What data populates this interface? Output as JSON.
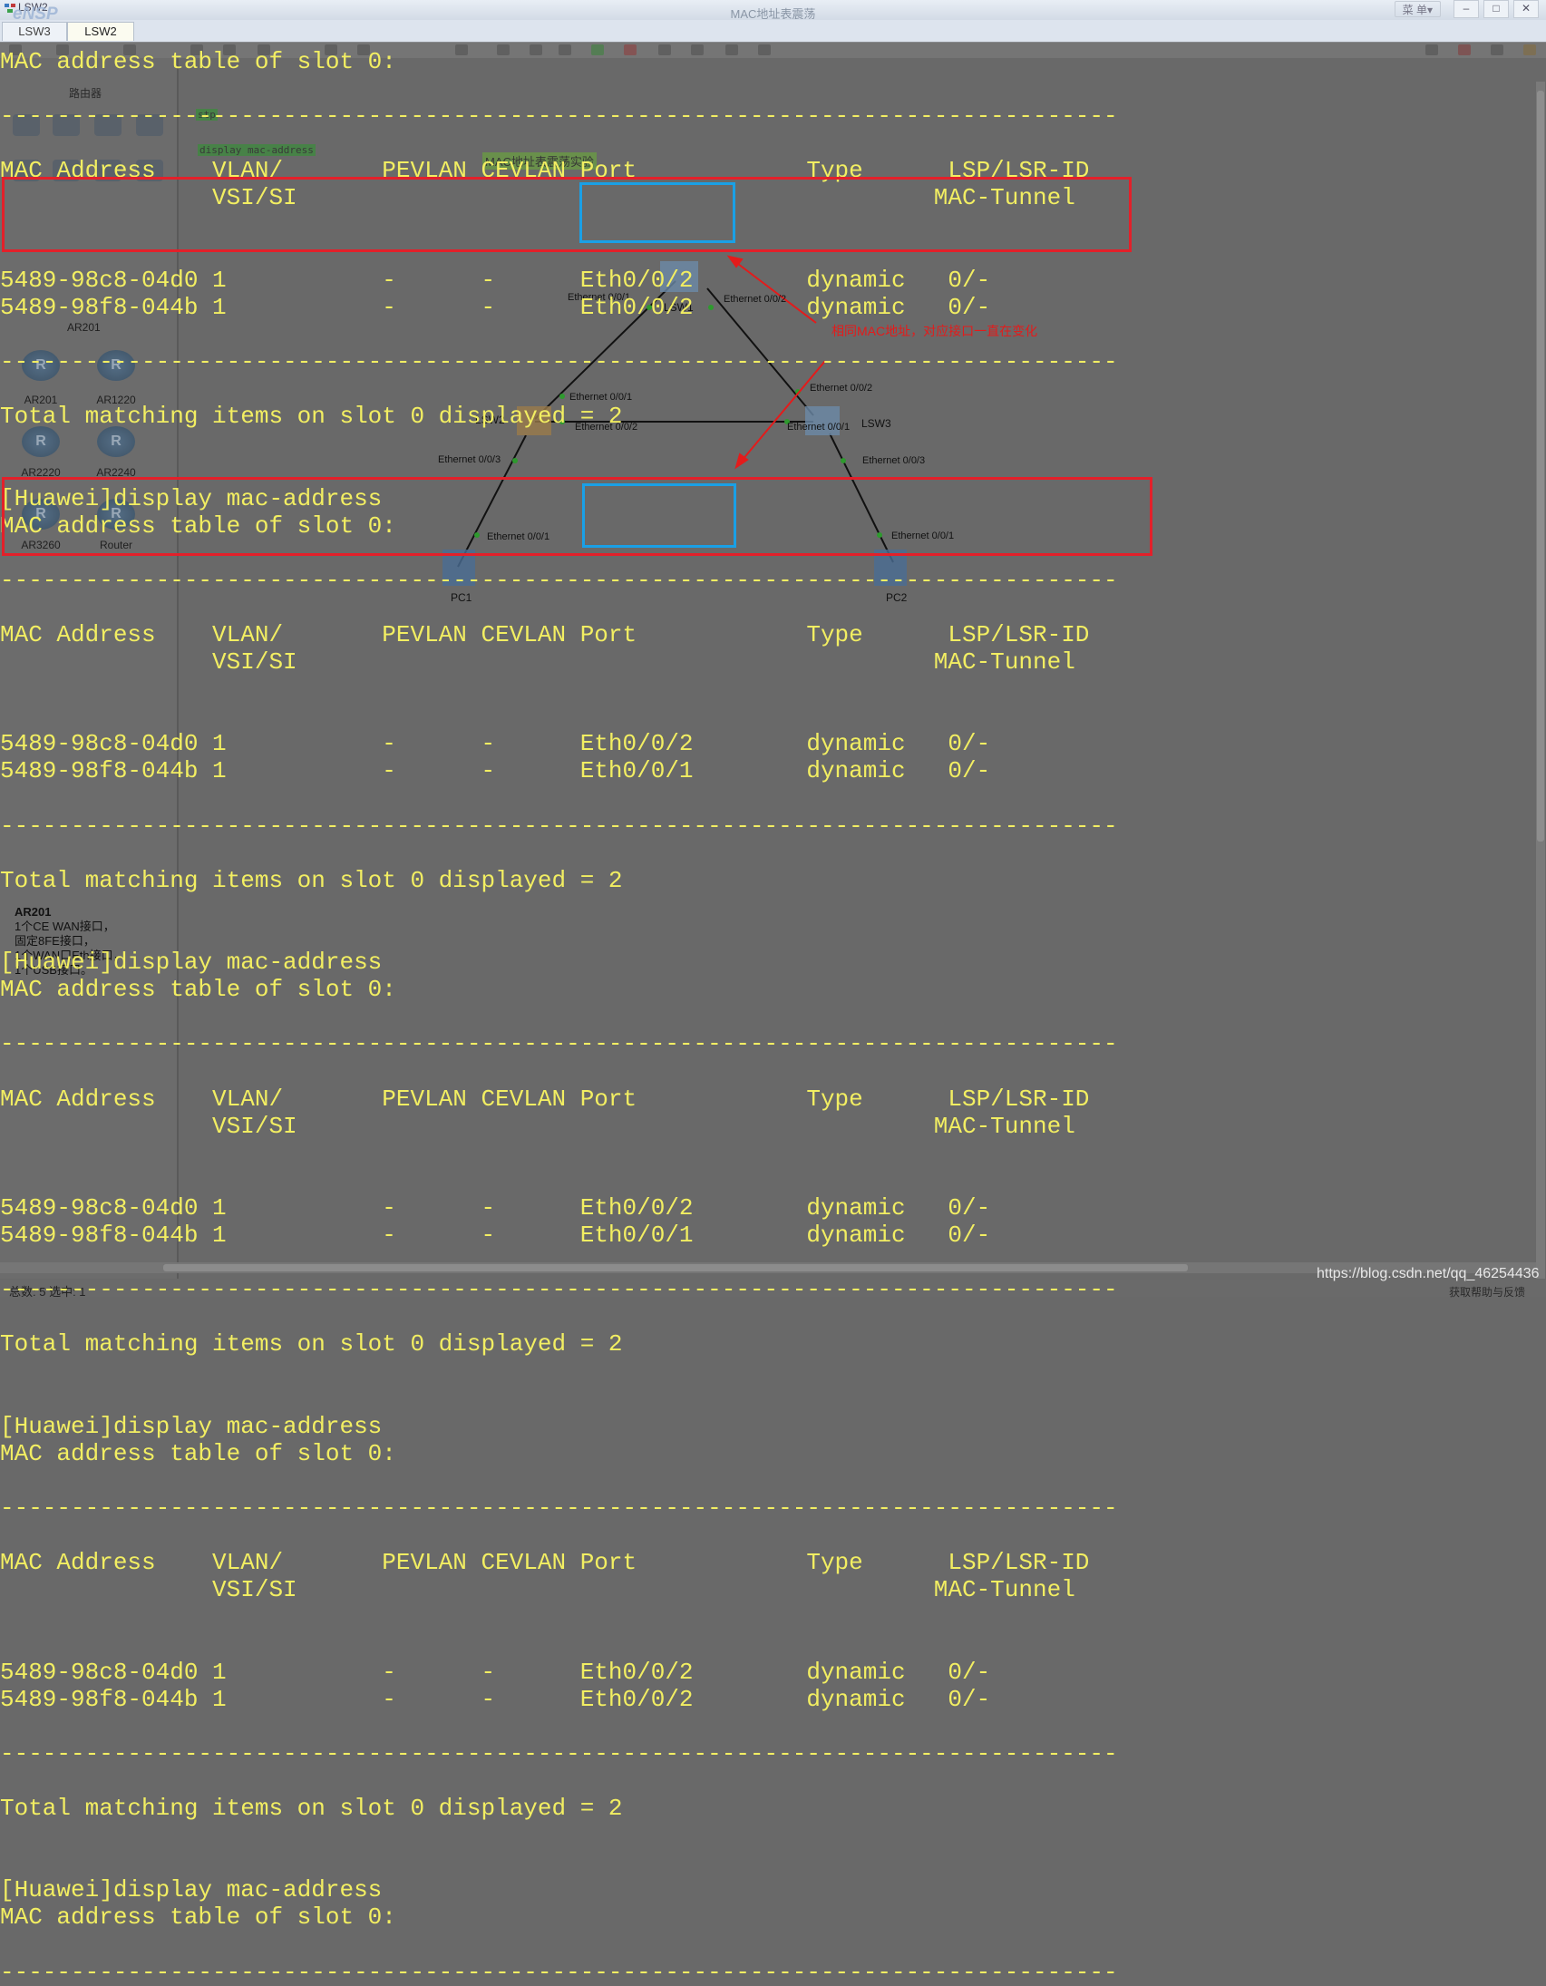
{
  "window": {
    "app_label": "LSW2",
    "brand": "eNSP",
    "title": "MAC地址表震荡",
    "menu_label": "菜 单▾",
    "minimize": "–",
    "maximize": "□",
    "close": "✕"
  },
  "tabs": [
    {
      "label": "LSW3",
      "active": false
    },
    {
      "label": "LSW2",
      "active": true
    }
  ],
  "ghost": {
    "panel_heading": "路由器",
    "routers": [
      "AR201",
      "AR1220",
      "AR2220",
      "AR2240",
      "AR3260",
      "Router"
    ],
    "selected_group": "AR201",
    "tags": [
      "stp",
      "display mac-address",
      "MAC地址表震荡实验"
    ],
    "nodes": [
      "LSW1",
      "LSW2",
      "LSW3",
      "PC1",
      "PC2"
    ],
    "ports": [
      "Ethernet 0/0/1",
      "Ethernet 0/0/2",
      "Ethernet 0/0/1",
      "Ethernet 0/0/2",
      "Ethernet 0/0/2",
      "Ethernet 0/0/1",
      "Ethernet 0/0/3",
      "Ethernet 0/0/3",
      "Ethernet 0/0/1",
      "Ethernet 0/0/1"
    ],
    "annotation": "相同MAC地址，对应接口一直在变化",
    "info": {
      "title": "AR201",
      "lines": [
        "1个CE WAN接口，",
        "固定8FE接口，",
        "1个WAN口Eth接口，",
        "1个USB接口。"
      ]
    },
    "status_left": "总数: 5 选中: 1",
    "status_right": "获取帮助与反馈"
  },
  "watermark": "https://blog.csdn.net/qq_46254436",
  "accent_colors": {
    "terminal_text": "#f2ee62",
    "highlight_red": "#e3202a",
    "highlight_blue": "#1aa0e6"
  },
  "terminal": {
    "lines": [
      "MAC address table of slot 0:",
      "",
      "-------------------------------------------------------------------------------",
      "",
      "MAC Address    VLAN/       PEVLAN CEVLAN Port            Type      LSP/LSR-ID",
      "               VSI/SI                                             MAC-Tunnel",
      "",
      "",
      "5489-98c8-04d0 1           -      -      Eth0/0/2        dynamic   0/-",
      "5489-98f8-044b 1           -      -      Eth0/0/2        dynamic   0/-",
      "",
      "-------------------------------------------------------------------------------",
      "",
      "Total matching items on slot 0 displayed = 2",
      "",
      "",
      "[Huawei]display mac-address",
      "MAC address table of slot 0:",
      "",
      "-------------------------------------------------------------------------------",
      "",
      "MAC Address    VLAN/       PEVLAN CEVLAN Port            Type      LSP/LSR-ID",
      "               VSI/SI                                             MAC-Tunnel",
      "",
      "",
      "5489-98c8-04d0 1           -      -      Eth0/0/2        dynamic   0/-",
      "5489-98f8-044b 1           -      -      Eth0/0/1        dynamic   0/-",
      "",
      "-------------------------------------------------------------------------------",
      "",
      "Total matching items on slot 0 displayed = 2",
      "",
      "",
      "[Huawei]display mac-address",
      "MAC address table of slot 0:",
      "",
      "-------------------------------------------------------------------------------",
      "",
      "MAC Address    VLAN/       PEVLAN CEVLAN Port            Type      LSP/LSR-ID",
      "               VSI/SI                                             MAC-Tunnel",
      "",
      "",
      "5489-98c8-04d0 1           -      -      Eth0/0/2        dynamic   0/-",
      "5489-98f8-044b 1           -      -      Eth0/0/1        dynamic   0/-",
      "",
      "-------------------------------------------------------------------------------",
      "",
      "Total matching items on slot 0 displayed = 2",
      "",
      "",
      "[Huawei]display mac-address",
      "MAC address table of slot 0:",
      "",
      "-------------------------------------------------------------------------------",
      "",
      "MAC Address    VLAN/       PEVLAN CEVLAN Port            Type      LSP/LSR-ID",
      "               VSI/SI                                             MAC-Tunnel",
      "",
      "",
      "5489-98c8-04d0 1           -      -      Eth0/0/2        dynamic   0/-",
      "5489-98f8-044b 1           -      -      Eth0/0/2        dynamic   0/-",
      "",
      "-------------------------------------------------------------------------------",
      "",
      "Total matching items on slot 0 displayed = 2",
      "",
      "",
      "[Huawei]display mac-address",
      "MAC address table of slot 0:",
      "",
      "-------------------------------------------------------------------------------"
    ]
  }
}
